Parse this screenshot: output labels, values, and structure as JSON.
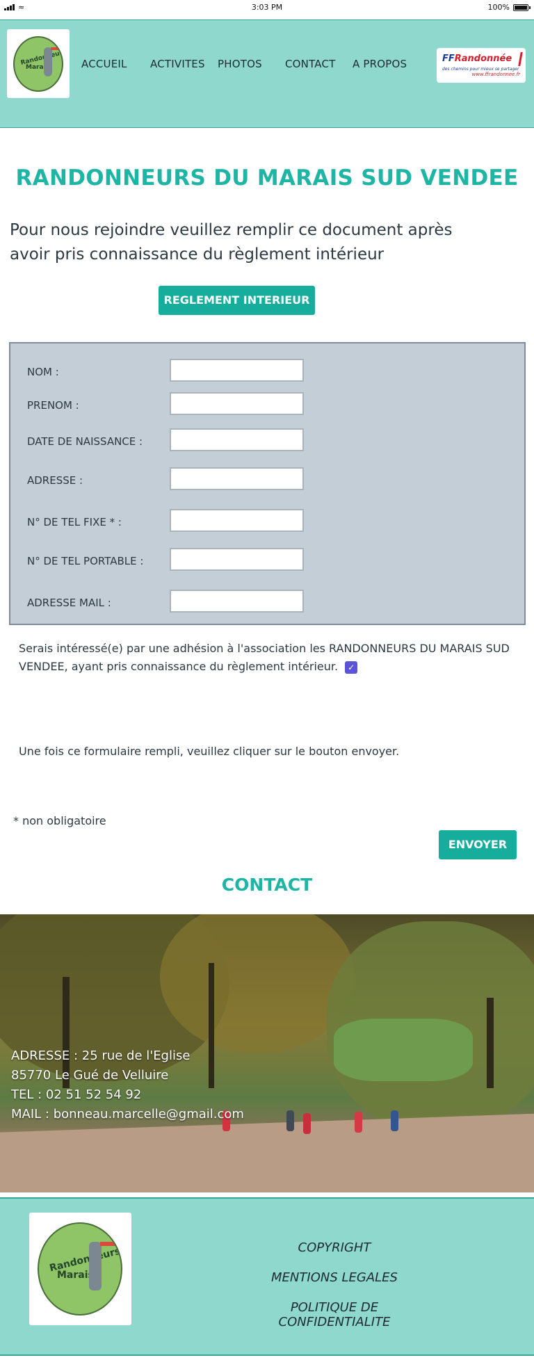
{
  "status_bar": {
    "time": "3:03 PM",
    "battery": "100%"
  },
  "header": {
    "logo_text_line1": "Randonneurs",
    "logo_text_line2": "Marais",
    "nav": [
      "ACCUEIL",
      "ACTIVITES",
      "PHOTOS",
      "CONTACT",
      "A PROPOS"
    ],
    "partner_logo": {
      "brand_ff": "FF",
      "brand_name": "Randonnée",
      "tagline": "des chemins pour mieux se partager",
      "url": "www.ffrandonnee.fr"
    }
  },
  "main": {
    "title": "RANDONNEURS DU MARAIS SUD VENDEE",
    "intro": "Pour nous rejoindre veuillez remplir ce document après avoir pris connaissance du règlement intérieur",
    "reglement_button": "REGLEMENT INTERIEUR"
  },
  "form": {
    "fields": [
      {
        "label": "NOM :",
        "value": ""
      },
      {
        "label": "PRENOM :",
        "value": ""
      },
      {
        "label": "DATE DE NAISSANCE :",
        "value": ""
      },
      {
        "label": "ADRESSE :",
        "value": ""
      },
      {
        "label": "N° DE TEL FIXE * :",
        "value": ""
      },
      {
        "label": "N° DE TEL PORTABLE :",
        "value": ""
      },
      {
        "label": "ADRESSE MAIL :",
        "value": ""
      }
    ],
    "consent_text": "Serais intéressé(e) par une adhésion à l'association les RANDONNEURS DU MARAIS SUD VENDEE, ayant pris connaissance du règlement intérieur.",
    "consent_checked": true,
    "instructions": "Une fois ce formulaire rempli, veuillez cliquer sur le bouton envoyer.",
    "optional_note": "* non obligatoire",
    "submit_label": "ENVOYER"
  },
  "contact": {
    "heading": "CONTACT",
    "address_line1": "ADRESSE :  25 rue de l'Eglise",
    "address_line2": "85770 Le Gué de Velluire",
    "phone": "TEL : 02 51 52 54 92",
    "email": "MAIL : bonneau.marcelle@gmail.com"
  },
  "footer": {
    "links": [
      "COPYRIGHT",
      "MENTIONS LEGALES",
      "POLITIQUE DE CONFIDENTIALITE"
    ]
  },
  "colors": {
    "accent": "#1fb5a4",
    "header_bg": "#8ed8cd",
    "button": "#17ad9c",
    "form_bg": "#c4ced7",
    "checkbox": "#5b54d6"
  }
}
